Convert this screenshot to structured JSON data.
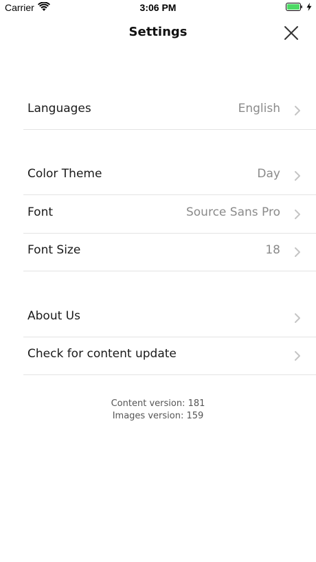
{
  "status_bar": {
    "carrier": "Carrier",
    "time": "3:06 PM",
    "wifi_icon": "wifi-icon",
    "battery_icon": "battery-icon",
    "charging_icon": "bolt-icon",
    "battery_color": "#4cd964"
  },
  "nav": {
    "title": "Settings",
    "close_icon": "close-icon"
  },
  "sections": [
    {
      "rows": [
        {
          "label": "Languages",
          "value": "English"
        }
      ]
    },
    {
      "rows": [
        {
          "label": "Color Theme",
          "value": "Day"
        },
        {
          "label": "Font",
          "value": "Source Sans Pro"
        },
        {
          "label": "Font Size",
          "value": "18"
        }
      ]
    },
    {
      "rows": [
        {
          "label": "About Us",
          "value": ""
        },
        {
          "label": "Check for content update",
          "value": ""
        }
      ]
    }
  ],
  "footer": {
    "content_version": "Content version: 181",
    "images_version": "Images version: 159"
  },
  "colors": {
    "separator": "#e3e3e3",
    "value_text": "#8a8a8a",
    "chevron": "#c4c4c4"
  }
}
